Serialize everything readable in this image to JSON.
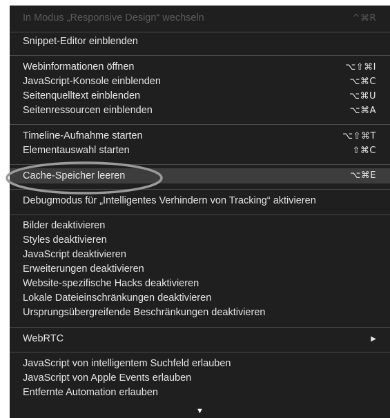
{
  "menu": {
    "items": [
      {
        "label": "In Modus „Responsive Design“ wechseln",
        "shortcut": "^⌘R",
        "state": "disabled"
      },
      {
        "label": "Snippet-Editor einblenden",
        "shortcut": ""
      },
      {
        "label": "Webinformationen öffnen",
        "shortcut": "⌥⇧⌘I"
      },
      {
        "label": "JavaScript-Konsole einblenden",
        "shortcut": "⌥⌘C"
      },
      {
        "label": "Seitenquelltext einblenden",
        "shortcut": "⌥⌘U"
      },
      {
        "label": "Seitenressourcen einblenden",
        "shortcut": "⌥⌘A"
      },
      {
        "label": "Timeline-Aufnahme starten",
        "shortcut": "⌥⇧⌘T"
      },
      {
        "label": "Elementauswahl starten",
        "shortcut": "⇧⌘C"
      },
      {
        "label": "Cache-Speicher leeren",
        "shortcut": "⌥⌘E",
        "state": "highlighted"
      },
      {
        "label": "Debugmodus für „Intelligentes Verhindern von Tracking“ aktivieren",
        "shortcut": ""
      },
      {
        "label": "Bilder deaktivieren",
        "shortcut": ""
      },
      {
        "label": "Styles deaktivieren",
        "shortcut": ""
      },
      {
        "label": "JavaScript deaktivieren",
        "shortcut": ""
      },
      {
        "label": "Erweiterungen deaktivieren",
        "shortcut": ""
      },
      {
        "label": "Website-spezifische Hacks deaktivieren",
        "shortcut": ""
      },
      {
        "label": "Lokale Dateieinschränkungen deaktivieren",
        "shortcut": ""
      },
      {
        "label": "Ursprungsübergreifende Beschränkungen deaktivieren",
        "shortcut": ""
      },
      {
        "label": "WebRTC",
        "submenu_icon": "▶"
      },
      {
        "label": "JavaScript von intelligentem Suchfeld erlauben",
        "shortcut": ""
      },
      {
        "label": "JavaScript von Apple Events erlauben",
        "shortcut": ""
      },
      {
        "label": "Entfernte Automation erlauben",
        "shortcut": ""
      }
    ],
    "scroll_indicator_icon": "▼"
  },
  "colors": {
    "menu_background": "#1f1f1f",
    "menu_text": "#e6e6e6",
    "disabled_text": "#5a5a5a",
    "highlight_background": "#3d3d3d",
    "separator": "#4a4a4a",
    "annotation_ring": "#9a9a9a"
  }
}
